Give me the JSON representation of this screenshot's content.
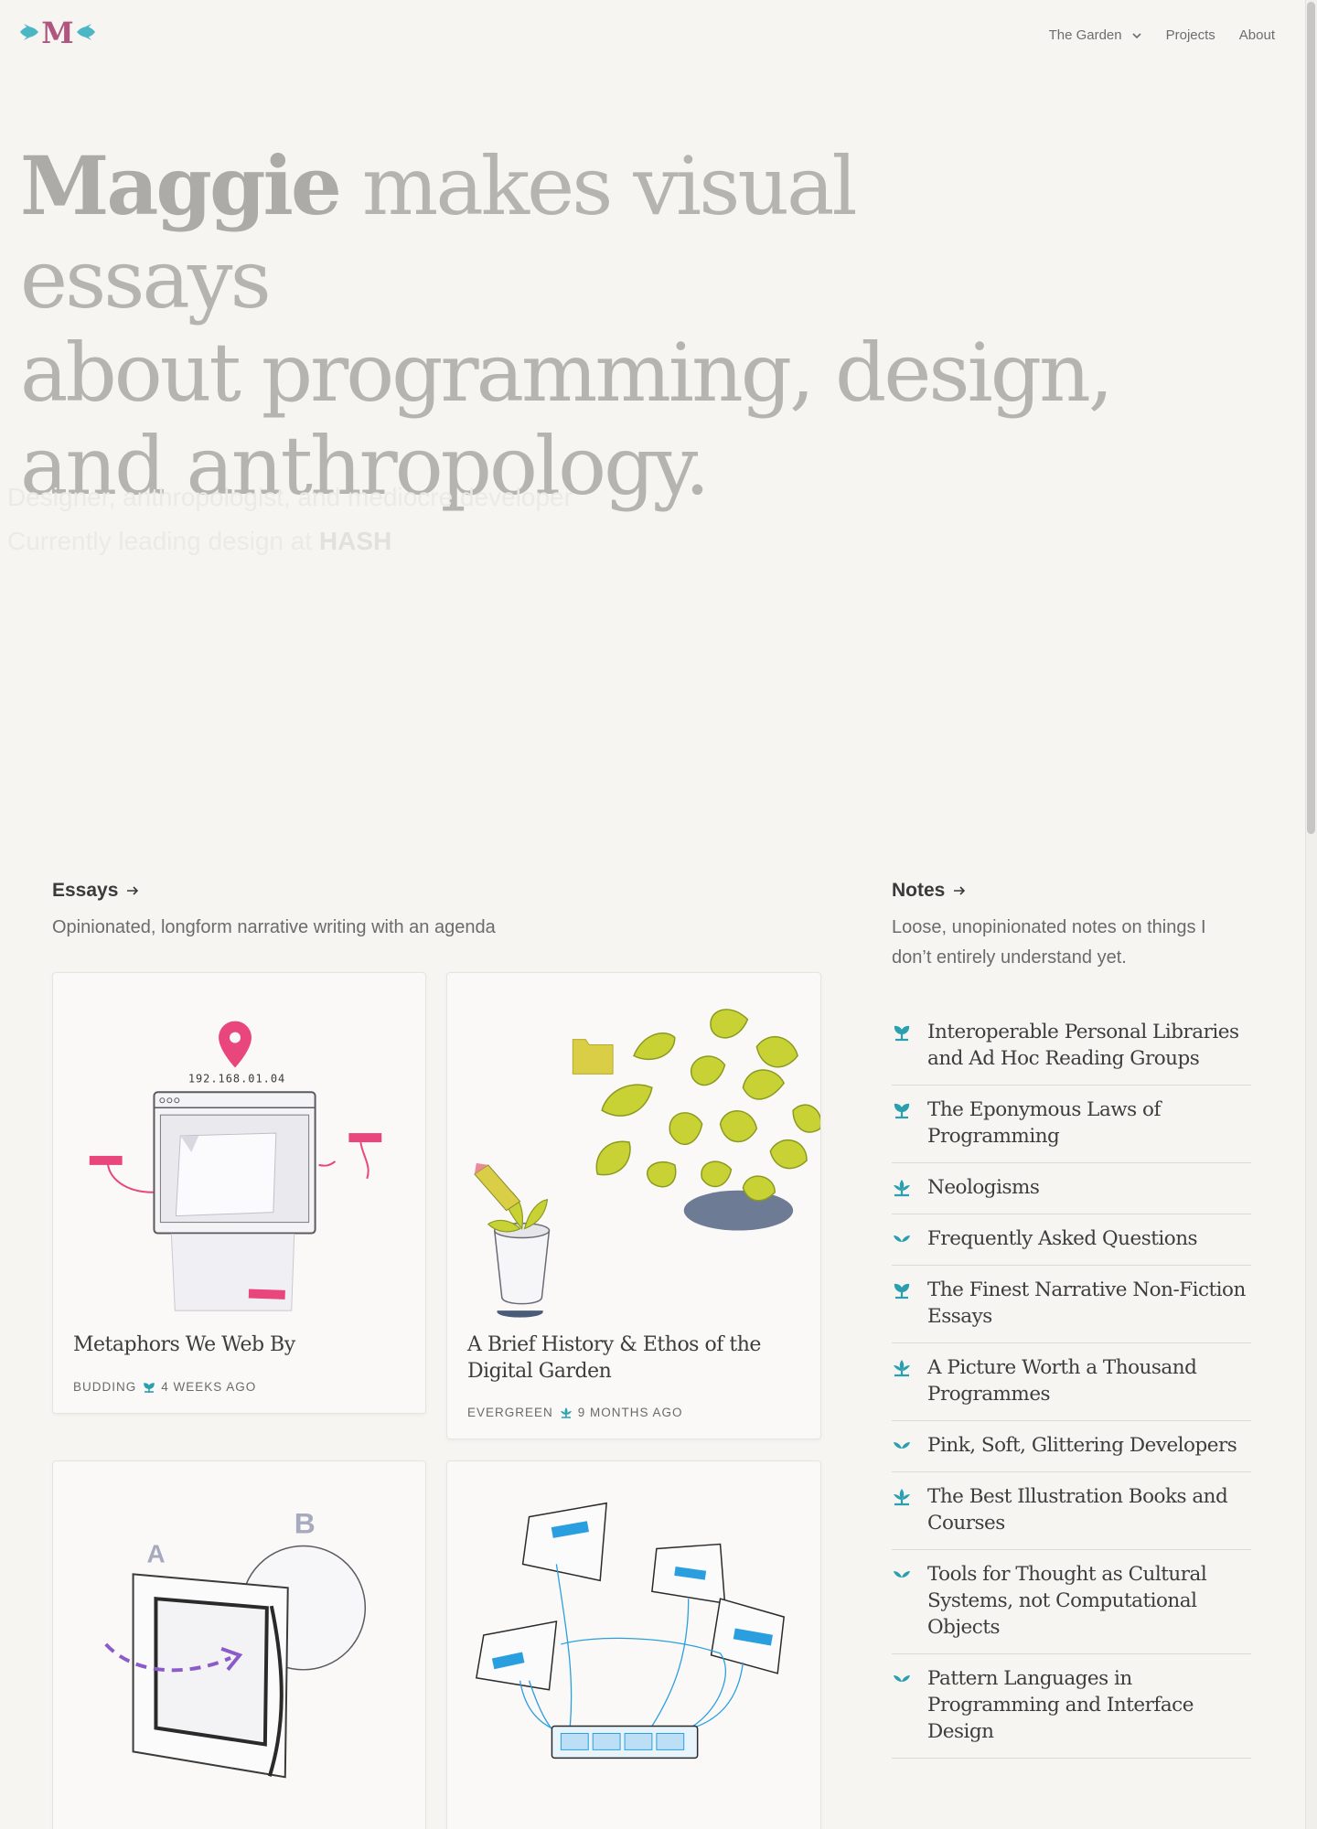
{
  "header": {
    "logo_letter": "M",
    "nav": [
      {
        "label": "The Garden",
        "has_dropdown": true
      },
      {
        "label": "Projects"
      },
      {
        "label": "About"
      }
    ]
  },
  "hero": {
    "title_name": "Maggie",
    "title_line1_rest": " makes visual essays",
    "title_line2": "about programming, design,",
    "title_line3": "and anthropology.",
    "sub_line1": "Designer, anthropologist, and mediocre developer",
    "sub_line2_prefix": "Currently leading design at ",
    "sub_line2_company": "HASH"
  },
  "essays": {
    "heading": "Essays",
    "description": "Opinionated, longform narrative writing with an agenda",
    "cards": [
      {
        "title": "Metaphors We Web By",
        "stage": "Budding",
        "age": "4 weeks ago",
        "ip_label": "192.168.01.04"
      },
      {
        "title": "A Brief History & Ethos of the Digital Garden",
        "stage": "Evergreen",
        "age": "9 months ago"
      },
      {
        "title": "",
        "stage": "",
        "age": "",
        "labels": [
          "A",
          "B"
        ]
      },
      {
        "title": "",
        "stage": "",
        "age": ""
      }
    ]
  },
  "notes": {
    "heading": "Notes",
    "description": "Loose, unopinionated notes on things I don’t entirely understand yet.",
    "items": [
      {
        "title": "Interoperable Personal Libraries and Ad Hoc Reading Groups",
        "stage": "budding"
      },
      {
        "title": "The Eponymous Laws of Programming",
        "stage": "budding"
      },
      {
        "title": "Neologisms",
        "stage": "evergreen"
      },
      {
        "title": "Frequently Asked Questions",
        "stage": "seedling"
      },
      {
        "title": "The Finest Narrative Non-Fiction Essays",
        "stage": "budding"
      },
      {
        "title": "A Picture Worth a Thousand Programmes",
        "stage": "evergreen"
      },
      {
        "title": "Pink, Soft, Glittering Developers",
        "stage": "seedling"
      },
      {
        "title": "The Best Illustration Books and Courses",
        "stage": "evergreen"
      },
      {
        "title": "Tools for Thought as Cultural Systems, not Computational Objects",
        "stage": "seedling"
      },
      {
        "title": "Pattern Languages in Programming and Interface Design",
        "stage": "seedling"
      }
    ]
  },
  "colors": {
    "accent_teal": "#2a9fb0",
    "pin_pink": "#e8467c",
    "plant_yellow": "#c9d235",
    "arrow_purple": "#8b5cc9",
    "screen_blue": "#2a9fe0"
  }
}
